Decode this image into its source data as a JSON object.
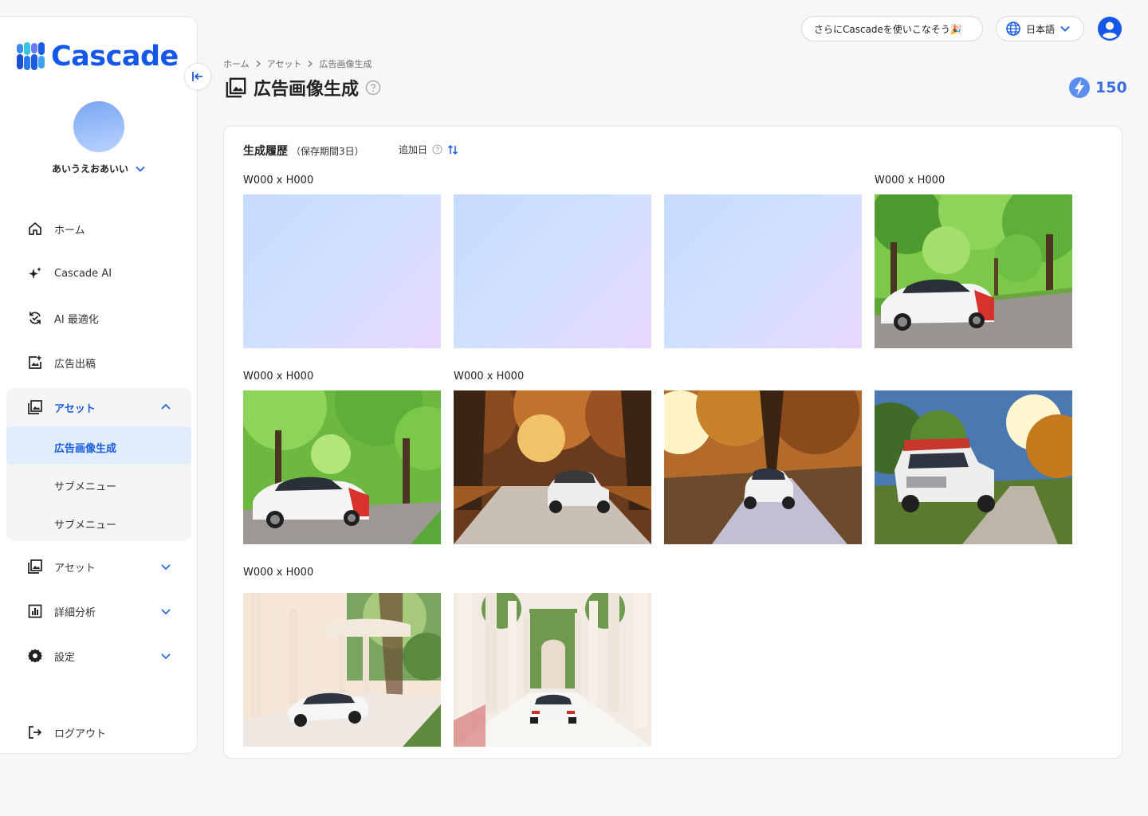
{
  "brand": {
    "name": "Cascade"
  },
  "user": {
    "name": "あいうえおあいい"
  },
  "nav": {
    "home": "ホーム",
    "cascade_ai": "Cascade AI",
    "ai_opt": "AI 最適化",
    "ad_post": "広告出稿",
    "asset_open": "アセット",
    "sub_active": "広告画像生成",
    "sub_1": "サブメニュー",
    "sub_2": "サブメニュー",
    "asset": "アセット",
    "analysis": "詳細分析",
    "settings": "設定",
    "logout": "ログアウト"
  },
  "header": {
    "promo": "さらにCascadeを使いこなそう🎉",
    "language": "日本語"
  },
  "breadcrumb": [
    "ホーム",
    "アセット",
    "広告画像生成"
  ],
  "page": {
    "title": "広告画像生成",
    "credits": "150"
  },
  "history": {
    "title": "生成履歴",
    "retention": "（保存期間3日）",
    "sort_label": "追加日"
  },
  "sizes": {
    "r1a": "W000 x H000",
    "r1b": "W000 x H000",
    "r2a": "W000 x H000",
    "r2b": "W000 x H000",
    "r3a": "W000 x H000"
  },
  "colors": {
    "accent": "#1557e8",
    "active_bg": "#e1ecfd",
    "credit": "#3b6fe0"
  }
}
